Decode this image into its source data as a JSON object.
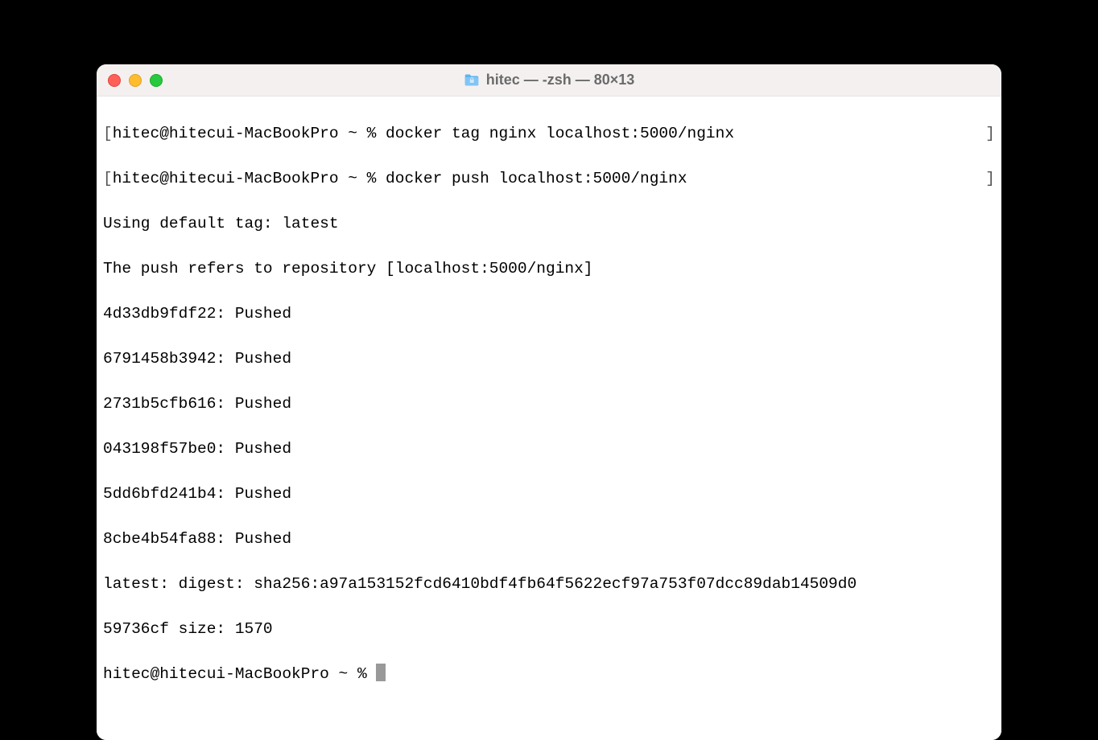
{
  "window": {
    "title": "hitec — -zsh — 80×13"
  },
  "terminal": {
    "lines": [
      {
        "left_bracket": "[",
        "text": "hitec@hitecui-MacBookPro ~ % docker tag nginx localhost:5000/nginx",
        "right_bracket": "]"
      },
      {
        "left_bracket": "[",
        "text": "hitec@hitecui-MacBookPro ~ % docker push localhost:5000/nginx",
        "right_bracket": "]"
      },
      {
        "text": "Using default tag: latest"
      },
      {
        "text": "The push refers to repository [localhost:5000/nginx]"
      },
      {
        "text": "4d33db9fdf22: Pushed "
      },
      {
        "text": "6791458b3942: Pushed "
      },
      {
        "text": "2731b5cfb616: Pushed "
      },
      {
        "text": "043198f57be0: Pushed "
      },
      {
        "text": "5dd6bfd241b4: Pushed "
      },
      {
        "text": "8cbe4b54fa88: Pushed "
      },
      {
        "text": "latest: digest: sha256:a97a153152fcd6410bdf4fb64f5622ecf97a753f07dcc89dab14509d0"
      },
      {
        "text": "59736cf size: 1570"
      }
    ],
    "prompt": "hitec@hitecui-MacBookPro ~ % "
  }
}
